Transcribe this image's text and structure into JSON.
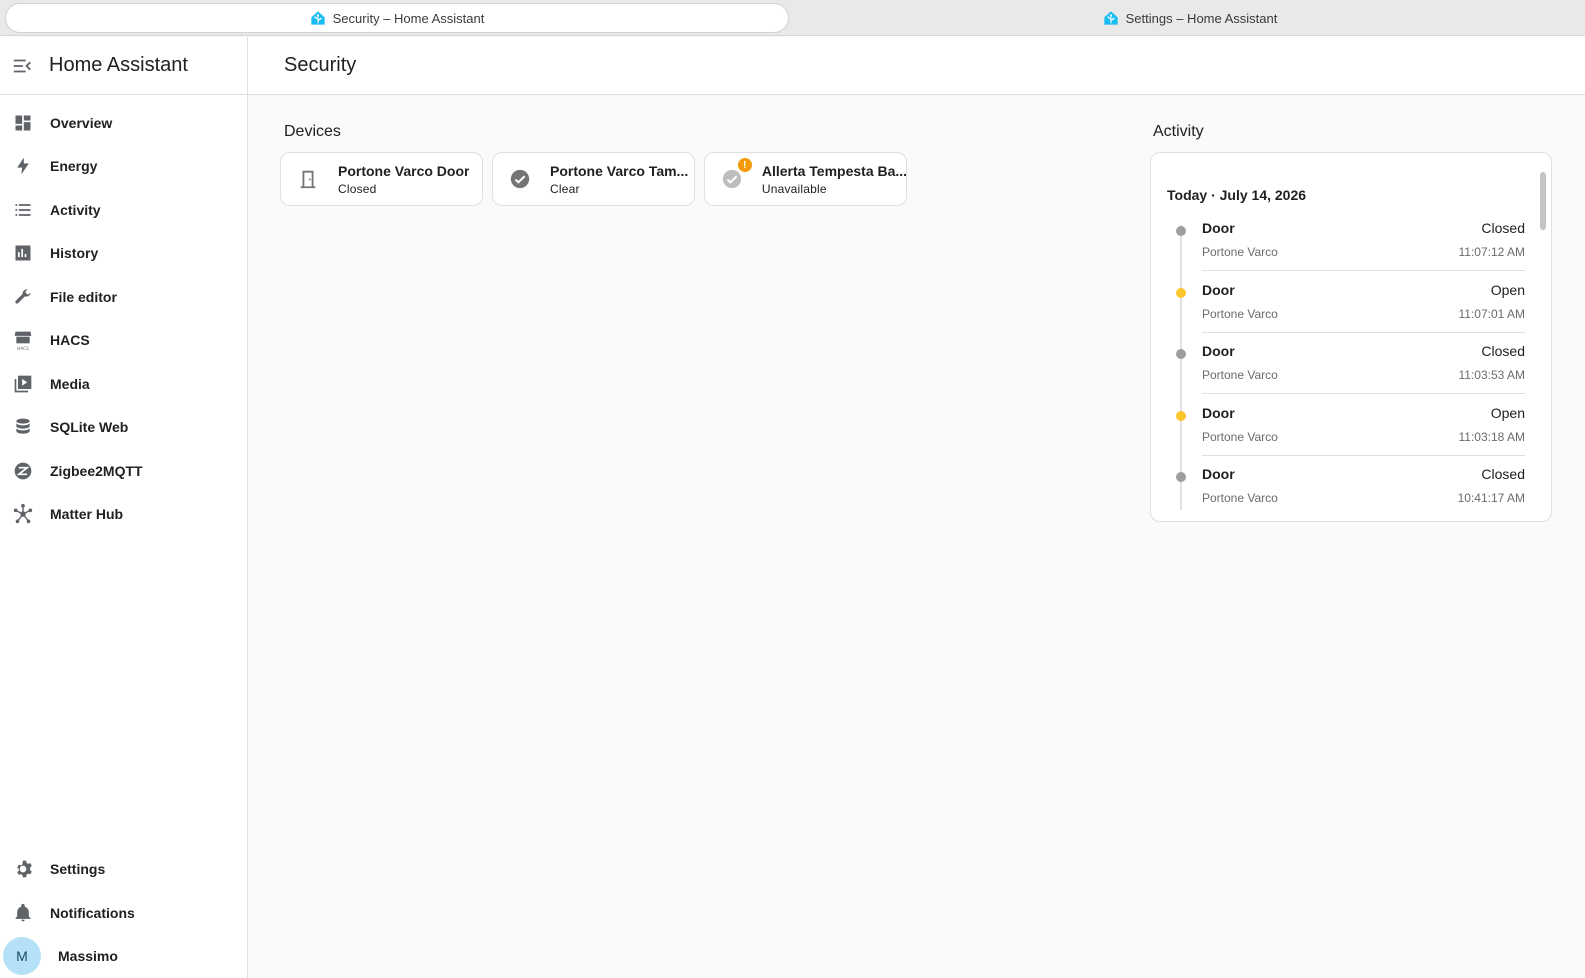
{
  "browser": {
    "tabs": [
      {
        "title": "Security – Home Assistant"
      },
      {
        "title": "Settings – Home Assistant"
      }
    ]
  },
  "sidebar": {
    "title": "Home Assistant",
    "items": [
      {
        "label": "Overview",
        "icon": "dashboard-icon"
      },
      {
        "label": "Energy",
        "icon": "lightning-icon"
      },
      {
        "label": "Activity",
        "icon": "list-icon"
      },
      {
        "label": "History",
        "icon": "chart-icon"
      },
      {
        "label": "File editor",
        "icon": "wrench-icon"
      },
      {
        "label": "HACS",
        "icon": "hacs-store-icon"
      },
      {
        "label": "Media",
        "icon": "media-icon"
      },
      {
        "label": "SQLite Web",
        "icon": "database-icon"
      },
      {
        "label": "Zigbee2MQTT",
        "icon": "zigbee-icon"
      },
      {
        "label": "Matter Hub",
        "icon": "hub-icon"
      }
    ],
    "bottom": {
      "settings": "Settings",
      "notifications": "Notifications",
      "user": {
        "name": "Massimo",
        "initial": "M"
      }
    }
  },
  "page": {
    "title": "Security",
    "devices_title": "Devices",
    "activity_title": "Activity"
  },
  "devices": [
    {
      "name": "Portone Varco Door",
      "state": "Closed",
      "icon": "door-closed-icon"
    },
    {
      "name": "Portone Varco Tam...",
      "state": "Clear",
      "icon": "check-circle-icon"
    },
    {
      "name": "Allerta Tempesta Ba...",
      "state": "Unavailable",
      "icon": "check-circle-icon",
      "badge": "!"
    }
  ],
  "activity": {
    "date": "Today · July 14, 2026",
    "entries": [
      {
        "name": "Door",
        "state": "Closed",
        "source": "Portone Varco",
        "time": "11:07:12 AM",
        "color": "#9e9e9e"
      },
      {
        "name": "Door",
        "state": "Open",
        "source": "Portone Varco",
        "time": "11:07:01 AM",
        "color": "#fdc52d"
      },
      {
        "name": "Door",
        "state": "Closed",
        "source": "Portone Varco",
        "time": "11:03:53 AM",
        "color": "#9e9e9e"
      },
      {
        "name": "Door",
        "state": "Open",
        "source": "Portone Varco",
        "time": "11:03:18 AM",
        "color": "#fdc52d"
      },
      {
        "name": "Door",
        "state": "Closed",
        "source": "Portone Varco",
        "time": "10:41:17 AM",
        "color": "#9e9e9e"
      }
    ]
  },
  "colors": {
    "accent": "#03a9f4",
    "icon": "#5f6368",
    "open": "#fdc52d",
    "closed": "#9e9e9e",
    "warning": "#f29b0c"
  }
}
